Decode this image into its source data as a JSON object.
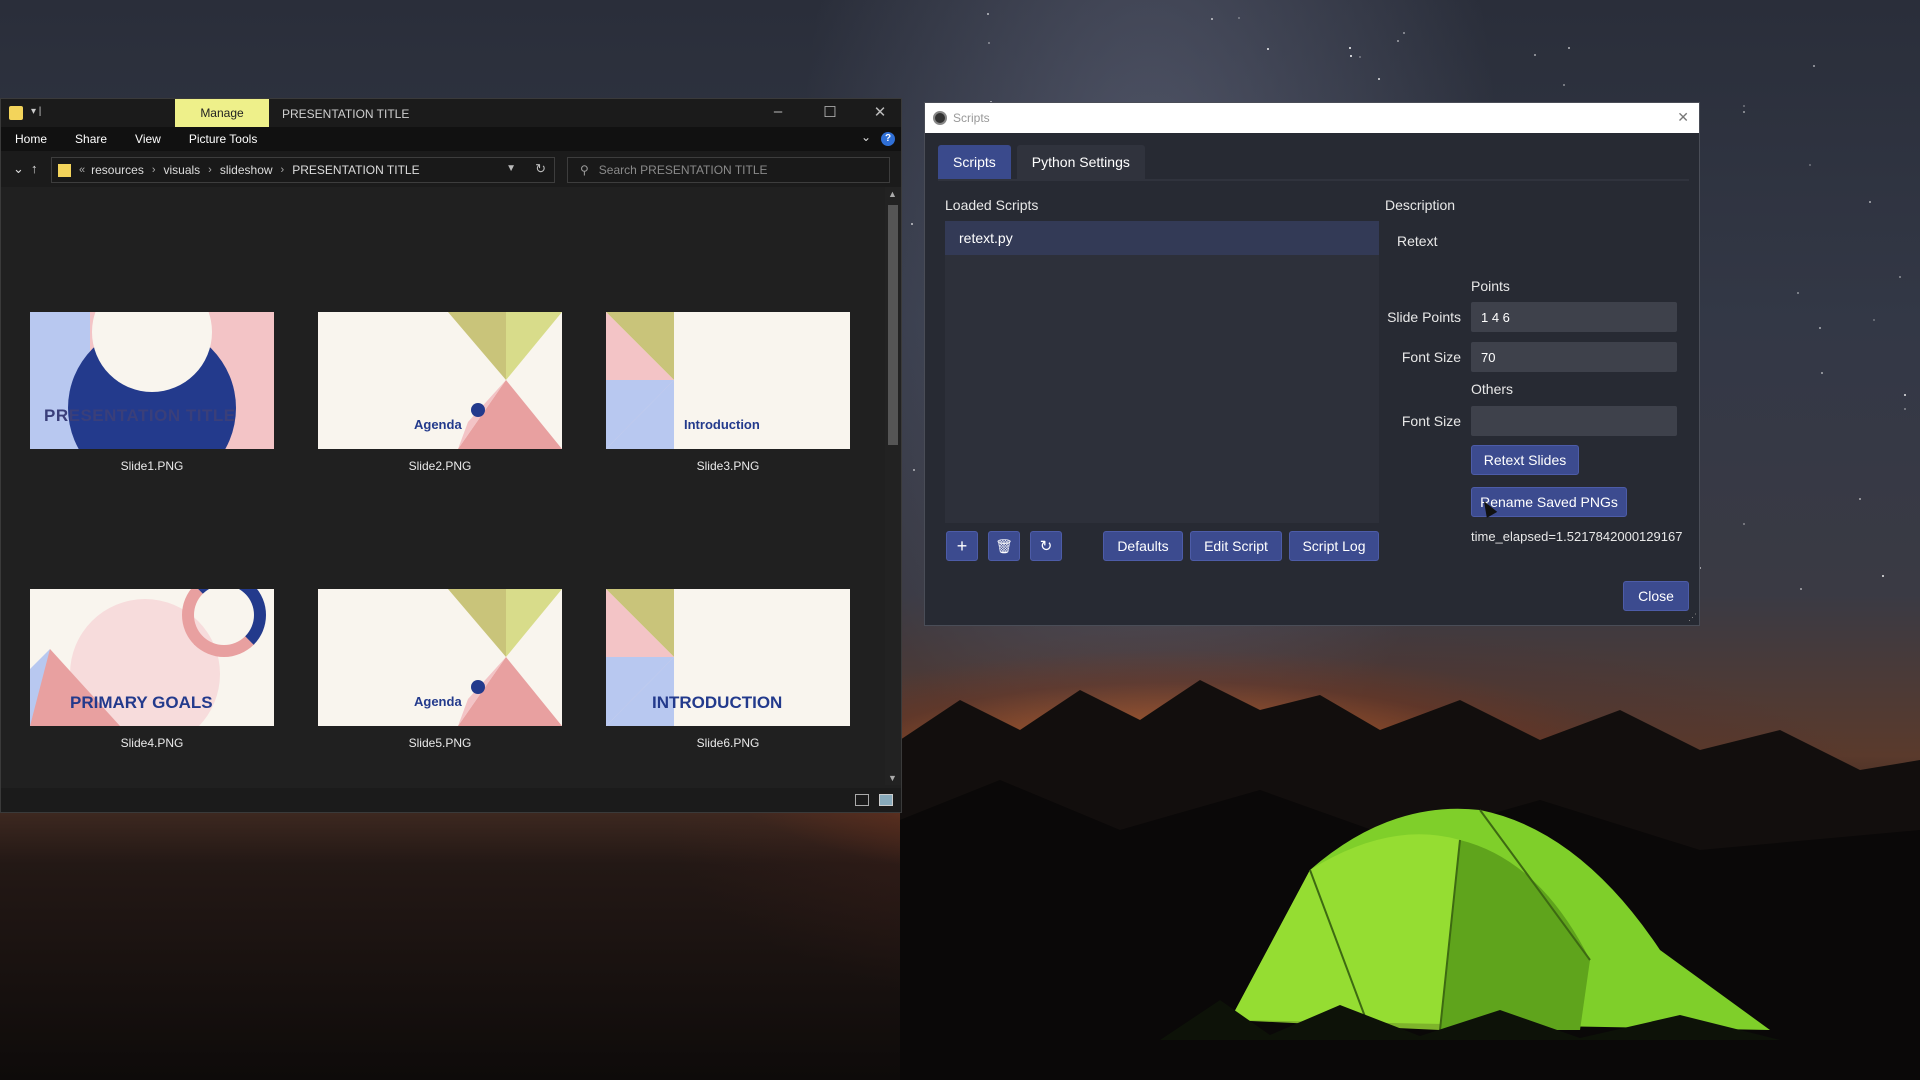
{
  "explorer": {
    "manage_tab": "Manage",
    "window_title": "PRESENTATION TITLE",
    "ribbon_tabs": [
      "Home",
      "Share",
      "View",
      "Picture Tools"
    ],
    "help_glyph": "?",
    "breadcrumb": [
      "resources",
      "visuals",
      "slideshow",
      "PRESENTATION TITLE"
    ],
    "search_placeholder": "Search PRESENTATION TITLE",
    "files": [
      {
        "name": "Slide1.PNG",
        "text": "PRESENTATION TITLE"
      },
      {
        "name": "Slide2.PNG",
        "text": "Agenda"
      },
      {
        "name": "Slide3.PNG",
        "text": "Introduction"
      },
      {
        "name": "Slide4.PNG",
        "text": "PRIMARY GOALS"
      },
      {
        "name": "Slide5.PNG",
        "text": "Agenda"
      },
      {
        "name": "Slide6.PNG",
        "text": "INTRODUCTION"
      }
    ],
    "colors": {
      "accent_pink": "#f3c4c6",
      "accent_blue": "#233a8c",
      "accent_olive": "#d6d07a",
      "accent_lightblue": "#b8c8f0"
    }
  },
  "scripts": {
    "window_title": "Scripts",
    "tabs": [
      "Scripts",
      "Python Settings"
    ],
    "loaded_scripts_label": "Loaded Scripts",
    "description_label": "Description",
    "scripts_list": [
      "retext.py"
    ],
    "description": "Retext",
    "points_header": "Points",
    "slide_points_label": "Slide Points",
    "slide_points_value": "1 4 6",
    "font_size_label": "Font Size",
    "font_size_value": "70",
    "others_header": "Others",
    "others_font_size_label": "Font Size",
    "others_font_size_value": "",
    "retext_button": "Retext Slides",
    "rename_button": "Rename Saved PNGs",
    "time_elapsed": "time_elapsed=1.5217842000129167",
    "defaults_button": "Defaults",
    "edit_script_button": "Edit Script",
    "script_log_button": "Script Log",
    "close_button": "Close",
    "icons": [
      "plus-icon",
      "trash-icon",
      "reload-icon"
    ]
  }
}
